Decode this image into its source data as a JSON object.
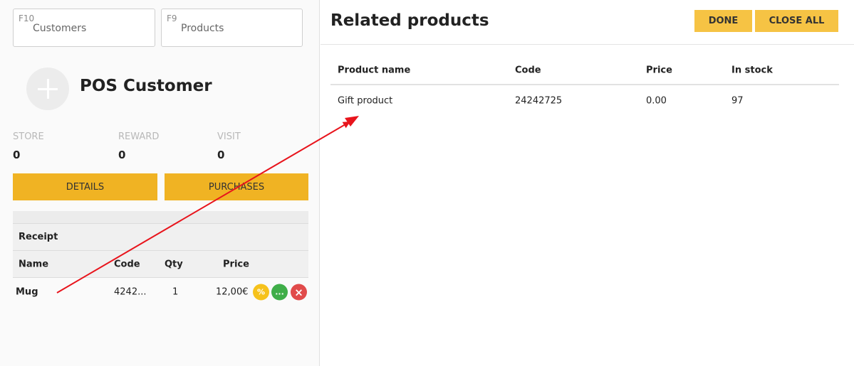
{
  "shortcuts": [
    {
      "key": "F10",
      "label": "Customers"
    },
    {
      "key": "F9",
      "label": "Products"
    }
  ],
  "customer": {
    "name": "POS Customer",
    "stats": [
      {
        "label": "STORE",
        "value": "0"
      },
      {
        "label": "REWARD",
        "value": "0"
      },
      {
        "label": "VISIT",
        "value": "0"
      }
    ],
    "details_label": "DETAILS",
    "purchases_label": "PURCHASES"
  },
  "receipt": {
    "title": "Receipt",
    "columns": [
      "Name",
      "Code",
      "Qty",
      "Price"
    ],
    "items": [
      {
        "name": "Mug",
        "code": "4242...",
        "qty": "1",
        "price": "12,00€",
        "discount_icon": "%",
        "more_icon": "...",
        "remove_icon": "×"
      }
    ]
  },
  "related": {
    "title": "Related products",
    "done_label": "DONE",
    "close_all_label": "CLOSE ALL",
    "columns": [
      "Product name",
      "Code",
      "Price",
      "In stock"
    ],
    "rows": [
      {
        "name": "Gift product",
        "code": "24242725",
        "price": "0.00",
        "stock": "97"
      }
    ]
  },
  "colors": {
    "accent": "#f0b323",
    "discount": "#f6c21c",
    "more": "#3fae49",
    "remove": "#e14b4b",
    "annotation_arrow": "#e8141c"
  }
}
